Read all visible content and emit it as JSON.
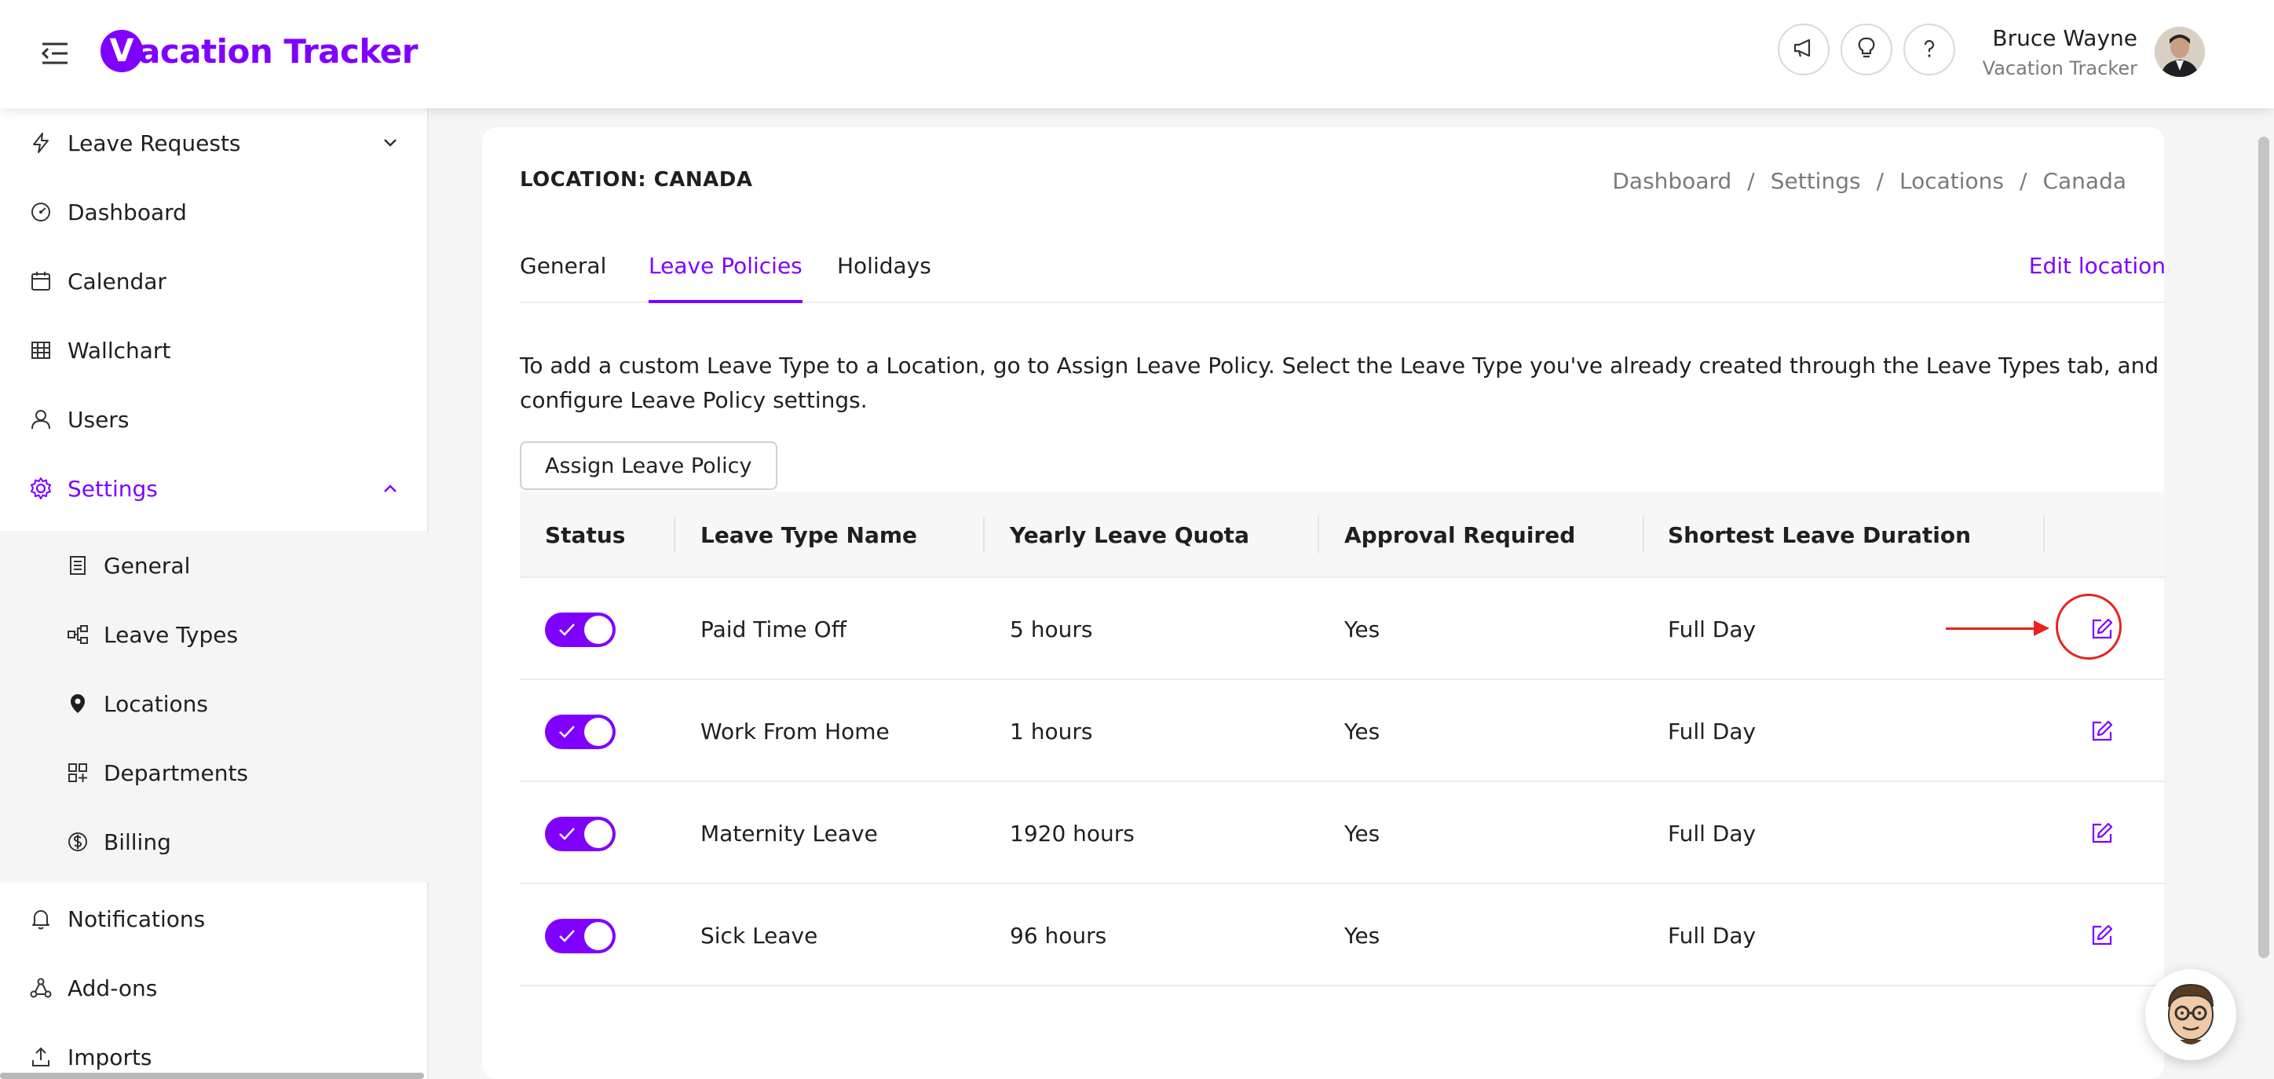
{
  "header": {
    "logo_mark": "V",
    "logo_text": "acation Tracker",
    "user_name": "Bruce Wayne",
    "user_company": "Vacation Tracker",
    "icons": [
      "menu-collapse-icon",
      "megaphone-icon",
      "lightbulb-icon",
      "help-icon"
    ]
  },
  "sidebar": {
    "items": [
      {
        "label": "Leave Requests",
        "icon": "lightning-icon"
      },
      {
        "label": "Dashboard",
        "icon": "gauge-icon"
      },
      {
        "label": "Calendar",
        "icon": "calendar-icon"
      },
      {
        "label": "Wallchart",
        "icon": "grid-icon"
      },
      {
        "label": "Users",
        "icon": "user-icon"
      },
      {
        "label": "Settings",
        "icon": "gear-icon"
      },
      {
        "label": "Notifications",
        "icon": "bell-icon"
      },
      {
        "label": "Add-ons",
        "icon": "addons-icon"
      },
      {
        "label": "Imports",
        "icon": "import-icon"
      }
    ],
    "settings_sub": [
      {
        "label": "General",
        "icon": "document-icon"
      },
      {
        "label": "Leave Types",
        "icon": "hierarchy-icon"
      },
      {
        "label": "Locations",
        "icon": "location-pin-icon"
      },
      {
        "label": "Departments",
        "icon": "departments-icon"
      },
      {
        "label": "Billing",
        "icon": "dollar-icon"
      }
    ]
  },
  "main": {
    "title": "LOCATION: CANADA",
    "breadcrumb": [
      "Dashboard",
      "/",
      "Settings",
      "/",
      "Locations",
      "/",
      "Canada"
    ],
    "tabs": [
      {
        "label": "General"
      },
      {
        "label": "Leave Policies"
      },
      {
        "label": "Holidays"
      }
    ],
    "edit_location": "Edit location",
    "help_text": "To add a custom Leave Type to a Location, go to Assign Leave Policy. Select the Leave Type you've already created through the Leave Types tab, and configure Leave Policy settings.",
    "assign_button": "Assign Leave Policy",
    "table": {
      "headers": [
        "Status",
        "Leave Type Name",
        "Yearly Leave Quota",
        "Approval Required",
        "Shortest Leave Duration"
      ],
      "rows": [
        {
          "name": "Paid Time Off",
          "quota": "5 hours",
          "approval": "Yes",
          "duration": "Full Day"
        },
        {
          "name": "Work From Home",
          "quota": "1 hours",
          "approval": "Yes",
          "duration": "Full Day"
        },
        {
          "name": "Maternity Leave",
          "quota": "1920 hours",
          "approval": "Yes",
          "duration": "Full Day"
        },
        {
          "name": "Sick Leave",
          "quota": "96 hours",
          "approval": "Yes",
          "duration": "Full Day"
        }
      ]
    }
  },
  "colors": {
    "accent": "#7f00ff",
    "annotation": "#e8231f",
    "text": "#1f1f1f",
    "muted": "#7a7a7a"
  }
}
